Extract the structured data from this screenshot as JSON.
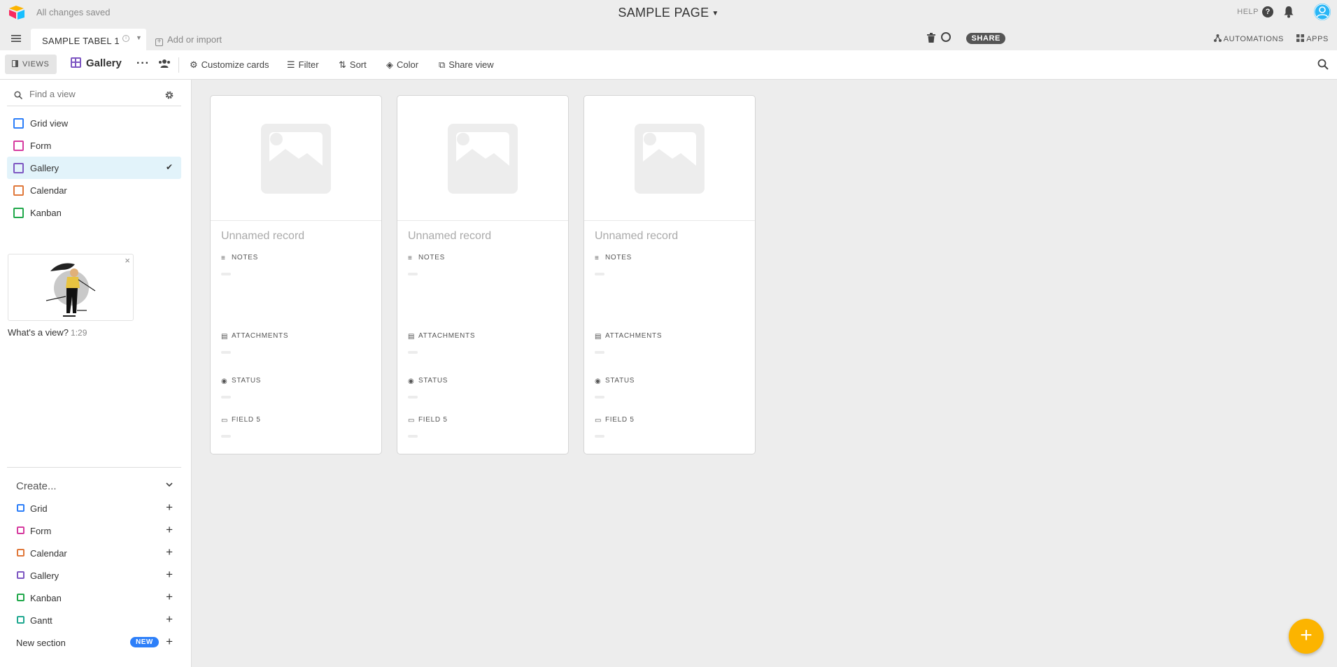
{
  "header": {
    "saved_status": "All changes saved",
    "page_title": "SAMPLE PAGE",
    "help_label": "HELP"
  },
  "tabs": {
    "table_name": "SAMPLE TABEL 1",
    "add_import": "Add or import",
    "share_label": "SHARE",
    "automations_label": "AUTOMATIONS",
    "apps_label": "APPS"
  },
  "viewbar": {
    "views_label": "VIEWS",
    "current_view": "Gallery",
    "customize_cards": "Customize cards",
    "filter": "Filter",
    "sort": "Sort",
    "color": "Color",
    "share_view": "Share view"
  },
  "sidebar": {
    "find_placeholder": "Find a view",
    "views": [
      {
        "label": "Grid view",
        "icon": "grid-icon",
        "color": "#2d7ff9"
      },
      {
        "label": "Form",
        "icon": "form-icon",
        "color": "#d63b9f"
      },
      {
        "label": "Gallery",
        "icon": "gallery-icon",
        "color": "#7e57c2",
        "active": true
      },
      {
        "label": "Calendar",
        "icon": "calendar-icon",
        "color": "#e0783a"
      },
      {
        "label": "Kanban",
        "icon": "kanban-icon",
        "color": "#20a84a"
      }
    ],
    "video_caption": "What's a view?",
    "video_duration": "1:29",
    "create_label": "Create...",
    "create_items": [
      {
        "label": "Grid",
        "icon": "grid-icon",
        "color": "#2d7ff9"
      },
      {
        "label": "Form",
        "icon": "form-icon",
        "color": "#d63b9f"
      },
      {
        "label": "Calendar",
        "icon": "calendar-icon",
        "color": "#e0783a"
      },
      {
        "label": "Gallery",
        "icon": "gallery-icon",
        "color": "#7e57c2"
      },
      {
        "label": "Kanban",
        "icon": "kanban-icon",
        "color": "#20a84a"
      },
      {
        "label": "Gantt",
        "icon": "gantt-icon",
        "color": "#1fa890"
      },
      {
        "label": "New section",
        "badge": "NEW"
      }
    ]
  },
  "cards": [
    {
      "title": "Unnamed record",
      "fields": [
        "NOTES",
        "ATTACHMENTS",
        "STATUS",
        "FIELD 5"
      ]
    },
    {
      "title": "Unnamed record",
      "fields": [
        "NOTES",
        "ATTACHMENTS",
        "STATUS",
        "FIELD 5"
      ]
    },
    {
      "title": "Unnamed record",
      "fields": [
        "NOTES",
        "ATTACHMENTS",
        "STATUS",
        "FIELD 5"
      ]
    }
  ],
  "colors": {
    "accent": "#fcb400",
    "active_view_bg": "#e2f3fa"
  }
}
